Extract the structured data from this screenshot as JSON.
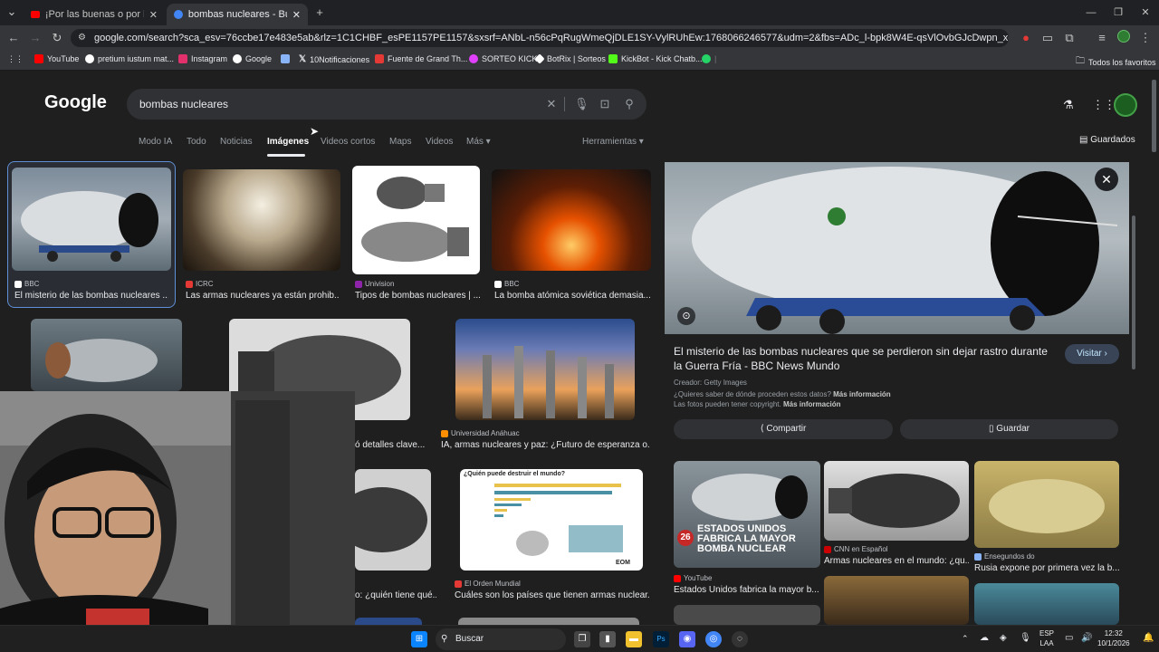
{
  "tabs": [
    {
      "title": "¡Por las buenas o por las malas!",
      "close": "✕"
    },
    {
      "title": "bombas nucleares - Buscar con Google",
      "close": "✕"
    }
  ],
  "new_tab": "+",
  "url": "google.com/search?sca_esv=76ccbe17e483e5ab&rlz=1C1CHBF_esPE1157PE1157&sxsrf=ANbL-n56cPqRugWmeQjDLE1SY-VylRUhEw:1768066246577&udm=2&fbs=ADc_l-bpk8W4E-qsVlOvbGJcDwpn_x-KoZgS_dlzvUJcCpPvNisF2DcSRPJpJf...",
  "bookmarks": [
    {
      "label": "YouTube",
      "color": "#ff0000"
    },
    {
      "label": "pretium iustum mat...",
      "color": "#ffffff"
    },
    {
      "label": "Instagram",
      "color": "#e1306c"
    },
    {
      "label": "Google",
      "color": "#4285f4"
    },
    {
      "label": "",
      "color": "#8ab4f8"
    },
    {
      "label": "10Notificaciones",
      "color": "#ffffff"
    },
    {
      "label": "Fuente de Grand Th...",
      "color": "#e53935"
    },
    {
      "label": "SORTEO KICK",
      "color": "#e040fb"
    },
    {
      "label": "BotRix | Sorteos",
      "color": "#ffffff"
    },
    {
      "label": "KickBot - Kick Chatb...",
      "color": "#53fc18"
    },
    {
      "label": "",
      "color": "#25d366"
    }
  ],
  "all_bookmarks": "Todos los favoritos",
  "google": {
    "logo": "Google",
    "query": "bombas nucleares",
    "nav": [
      "Modo IA",
      "Todo",
      "Noticias",
      "Imágenes",
      "Videos cortos",
      "Maps",
      "Videos",
      "Más ▾"
    ],
    "tools": "Herramientas ▾",
    "saved": "Guardados"
  },
  "results": [
    {
      "source": "BBC",
      "caption": "El misterio de las bombas nucleares ..."
    },
    {
      "source": "ICRC",
      "caption": "Las armas nucleares ya están prohib..."
    },
    {
      "source": "Univision",
      "caption": "Tipos de bombas nucleares | ..."
    },
    {
      "source": "BBC",
      "caption": "La bomba atómica soviética demasia..."
    },
    {
      "source": "Universidad Anáhuac",
      "caption": "IA, armas nucleares y paz: ¿Futuro de esperanza o..."
    },
    {
      "source": "",
      "caption": "ó detalles clave..."
    },
    {
      "source": "",
      "caption": "o: ¿quién tiene qué..."
    },
    {
      "source": "El Orden Mundial",
      "caption": "Cuáles son los países que tienen armas nuclear..."
    }
  ],
  "chart_thumb_title": "¿Quién puede destruir el mundo?",
  "chart_thumb_logo": "EOM",
  "panel": {
    "title": "El misterio de las bombas nucleares que se perdieron sin dejar rastro durante la Guerra Fría - BBC News Mundo",
    "visit": "Visitar ›",
    "creator": "Creador: Getty Images",
    "where": "¿Quieres saber de dónde proceden estos datos?",
    "more_info": "Más información",
    "copyright": "Las fotos pueden tener copyright.",
    "share": "Compartir",
    "save": "Guardar",
    "related": [
      {
        "source": "YouTube",
        "caption": "Estados Unidos fabrica la mayor b...",
        "overlay": "ESTADOS UNIDOS FABRICA LA MAYOR BOMBA NUCLEAR",
        "badge": "26"
      },
      {
        "source": "CNN en Español",
        "caption": "Armas nucleares en el mundo: ¿qu..."
      },
      {
        "source": "Ensegundos do",
        "caption": "Rusia expone por primera vez la b..."
      }
    ]
  },
  "taskbar": {
    "search": "Buscar",
    "lang": "ESP",
    "lang2": "LAA",
    "time": "12:32",
    "date": "10/1/2026"
  }
}
